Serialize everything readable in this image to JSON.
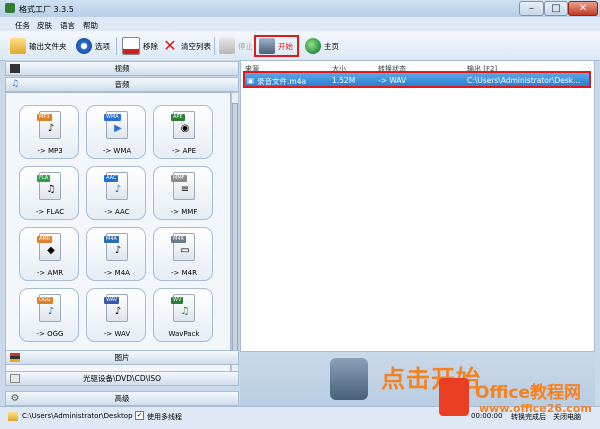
{
  "window": {
    "title": "格式工厂 3.3.5",
    "min": "–",
    "max": "□",
    "close": "✕"
  },
  "menu": [
    "任务",
    "皮肤",
    "语言",
    "帮助"
  ],
  "toolbar": {
    "output_folder": "输出文件夹",
    "options": "选项",
    "remove": "移除",
    "clear_list": "清空列表",
    "stop": "停止",
    "start": "开始",
    "home": "主页"
  },
  "sidebar": {
    "video": "视频",
    "audio": "音频",
    "picture": "图片",
    "optical": "光驱设备\\DVD\\CD\\ISO",
    "advanced": "高级"
  },
  "formats": [
    {
      "tag": "MP3",
      "label": "-> MP3",
      "color": "#d9822b",
      "glyph": "♪"
    },
    {
      "tag": "WMA",
      "label": "-> WMA",
      "color": "#2b6ed9",
      "glyph": "▶"
    },
    {
      "tag": "APE",
      "label": "-> APE",
      "color": "#2f7d32",
      "glyph": "◉"
    },
    {
      "tag": "FLA",
      "label": "-> FLAC",
      "color": "#2f9d4a",
      "glyph": "♫"
    },
    {
      "tag": "AAC",
      "label": "-> AAC",
      "color": "#1f6fd0",
      "glyph": "♪"
    },
    {
      "tag": "MMF",
      "label": "-> MMF",
      "color": "#8a8a8a",
      "glyph": "≡"
    },
    {
      "tag": "AMR",
      "label": "-> AMR",
      "color": "#d9822b",
      "glyph": "◆"
    },
    {
      "tag": "M4A",
      "label": "-> M4A",
      "color": "#2a6fa8",
      "glyph": "♪"
    },
    {
      "tag": "M4R",
      "label": "-> M4R",
      "color": "#6a7a8a",
      "glyph": "▭"
    },
    {
      "tag": "OGG",
      "label": "-> OGG",
      "color": "#d9822b",
      "glyph": "♪"
    },
    {
      "tag": "WAV",
      "label": "-> WAV",
      "color": "#3a5aa8",
      "glyph": "♪"
    },
    {
      "tag": "WV",
      "label": "WavPack",
      "color": "#2f7d32",
      "glyph": "♫"
    }
  ],
  "table": {
    "headers": [
      "来源",
      "大小",
      "转换状态",
      "输出 [F2]"
    ],
    "rows": [
      {
        "source": "录音文件.m4a",
        "size": "1.52M",
        "status": "-> WAV",
        "output": "C:\\Users\\Administrator\\Desk..."
      }
    ]
  },
  "big_start": "点击开始",
  "status": {
    "path": "C:\\Users\\Administrator\\Desktop",
    "checkbox_mark": "✓",
    "multithread": "使用多线程",
    "time": "00:00:00",
    "after_done": "转换完成后",
    "shutdown": "关闭电脑"
  },
  "watermark": {
    "brand": "Office教程网",
    "url": "www.office26.com"
  },
  "colors": {
    "highlight_border": "#e0191b",
    "selection": "#2a7fd0",
    "accent_orange": "#f58220"
  }
}
